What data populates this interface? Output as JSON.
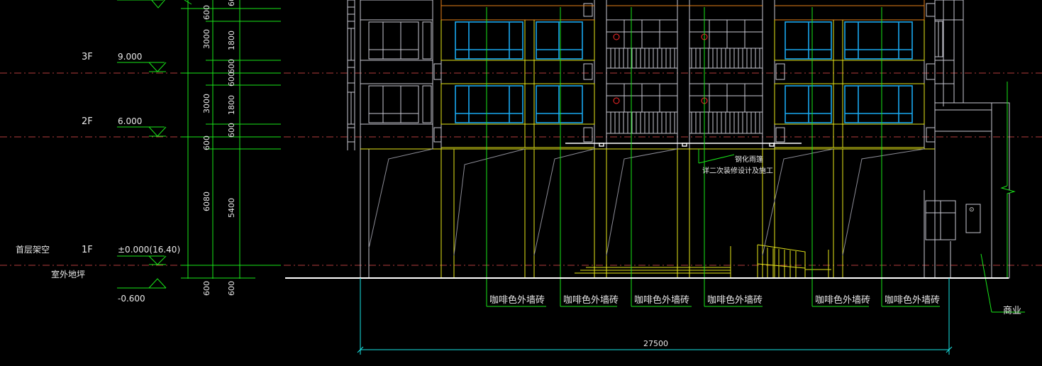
{
  "drawing": {
    "colors": {
      "background": "#000000",
      "level_line": "#b23c3c",
      "dimension": "#19e619",
      "grid_axis": "#19e619",
      "facade": "#c8c8d2",
      "window_blue": "#19a8f0",
      "slab_yellow": "#e6e619",
      "roof_orange": "#e67f19",
      "cyan_dim": "#19e6e6",
      "ground": "#ffffff",
      "mark_red": "#ff2a2a"
    },
    "levels": [
      {
        "id": "3f",
        "floor": "3F",
        "elevation": "9.000"
      },
      {
        "id": "2f",
        "floor": "2F",
        "elevation": "6.000"
      },
      {
        "id": "1f",
        "floor": "1F",
        "elevation": "±0.000(16.40)",
        "note": "首层架空"
      }
    ],
    "outdoor": {
      "label": "室外地坪",
      "elevation": "-0.600"
    },
    "dims_outer": [
      "3000",
      "3000",
      "6080",
      "600"
    ],
    "dims_inner": [
      "600",
      "1800",
      "600",
      "600",
      "1800",
      "600",
      "600",
      "5400",
      "600",
      "600"
    ],
    "callout": {
      "line1": "钢化雨篷",
      "line2": "详二次装修设计及施工"
    },
    "material_labels": [
      "咖啡色外墙砖",
      "咖啡色外墙砖",
      "咖啡色外墙砖",
      "咖啡色外墙砖",
      "咖啡色外墙砖",
      "咖啡色外墙砖"
    ],
    "commercial_label": "商业",
    "overall_dim": "27500",
    "fire_mark": "①",
    "sign_mark": "⊙"
  }
}
